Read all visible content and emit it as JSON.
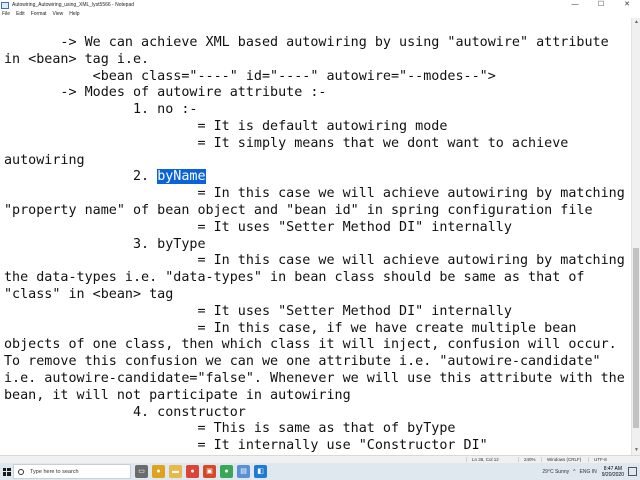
{
  "window": {
    "title": "Autowiring_Autowiring_using_XML_lyst5566 - Notepad",
    "controls": [
      "—",
      "☐",
      "✕"
    ]
  },
  "menu": [
    "File",
    "Edit",
    "Format",
    "View",
    "Help"
  ],
  "editor": {
    "lines": [
      [
        {
          "t": "       -> We can achieve XML based autowiring by using \"autowire\" attribute"
        }
      ],
      [
        {
          "t": "in <bean> tag i.e."
        }
      ],
      [
        {
          "t": "           <bean class=\"----\" id=\"----\" autowire=\"--modes--\">"
        }
      ],
      [
        {
          "t": "       -> Modes of autowire attribute :-"
        }
      ],
      [
        {
          "t": "                1. no :-"
        }
      ],
      [
        {
          "t": "                        = It is default autowiring mode"
        }
      ],
      [
        {
          "t": "                        = It simply means that we dont want to achieve"
        }
      ],
      [
        {
          "t": "autowiring"
        }
      ],
      [
        {
          "t": "                2. "
        },
        {
          "t": "byName",
          "sel": true
        }
      ],
      [
        {
          "t": "                        = In this case we will achieve autowiring by matching"
        }
      ],
      [
        {
          "t": "\"property name\" of bean object and \"bean id\" in spring configuration file"
        }
      ],
      [
        {
          "t": "                        = It uses \"Setter Method DI\" internally"
        }
      ],
      [
        {
          "t": "                3. byType"
        }
      ],
      [
        {
          "t": "                        = In this case we will achieve autowiring by matching"
        }
      ],
      [
        {
          "t": "the data-types i.e. \"data-types\" in bean class should be same as that of"
        }
      ],
      [
        {
          "t": "\"class\" in <bean> tag"
        }
      ],
      [
        {
          "t": "                        = It uses \"Setter Method DI\" internally"
        }
      ],
      [
        {
          "t": "                        = In this case, if we have create multiple bean"
        }
      ],
      [
        {
          "t": "objects of one class, then which class it will inject, confusion will occur."
        }
      ],
      [
        {
          "t": "To remove this confusion we can we one attribute i.e. \"autowire-candidate\""
        }
      ],
      [
        {
          "t": "i.e. autowire-candidate=\"false\". Whenever we will use this attribute with the"
        }
      ],
      [
        {
          "t": "bean, it will not participate in autowiring"
        }
      ],
      [
        {
          "t": "                4. constructor"
        }
      ],
      [
        {
          "t": "                        = This is same as that of byType"
        }
      ],
      [
        {
          "t": "                        = It internally use \"Constructor DI\""
        }
      ]
    ]
  },
  "statusbar": {
    "position": "Ln 36, Col 12",
    "zoom": "240%",
    "line_ending": "Windows (CRLF)",
    "encoding": "UTF-8"
  },
  "taskbar": {
    "search_placeholder": "Type here to search",
    "apps": [
      {
        "name": "task-view-icon",
        "color": "#6b6b6b",
        "glyph": "▭"
      },
      {
        "name": "chrome-icon",
        "color": "#e0a21c",
        "glyph": "●"
      },
      {
        "name": "file-explorer-icon",
        "color": "#e8b84a",
        "glyph": "▬"
      },
      {
        "name": "chrome-icon",
        "color": "#db4437",
        "glyph": "●"
      },
      {
        "name": "office-icon",
        "color": "#d44a26",
        "glyph": "▣"
      },
      {
        "name": "chrome-icon",
        "color": "#3aa757",
        "glyph": "●"
      },
      {
        "name": "notepad-icon",
        "color": "#5b8fd6",
        "glyph": "▤"
      },
      {
        "name": "vscode-icon",
        "color": "#1f7ad6",
        "glyph": "◧"
      }
    ],
    "weather": "29°C Sunny",
    "language": "ENG IN",
    "time": "8:47 AM",
    "date": "9/20/2020"
  }
}
